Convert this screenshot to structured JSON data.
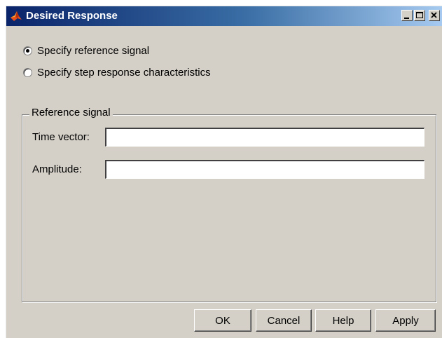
{
  "window": {
    "title": "Desired Response",
    "title_buttons": {
      "minimize_icon": "minimize-icon",
      "maximize_icon": "maximize-icon",
      "close_icon": "close-icon"
    },
    "app_icon": "matlab-membrane-icon"
  },
  "options": [
    {
      "label": "Specify reference signal",
      "checked": true
    },
    {
      "label": "Specify step response characteristics",
      "checked": false
    }
  ],
  "reference_group": {
    "title": "Reference signal",
    "time_vector": {
      "label": "Time vector:",
      "value": ""
    },
    "amplitude": {
      "label": "Amplitude:",
      "value": ""
    }
  },
  "buttons": {
    "ok": "OK",
    "cancel": "Cancel",
    "help": "Help",
    "apply": "Apply"
  },
  "colors": {
    "face": "#d4d0c8",
    "title_start": "#0a246a",
    "title_end": "#a6caf0"
  }
}
